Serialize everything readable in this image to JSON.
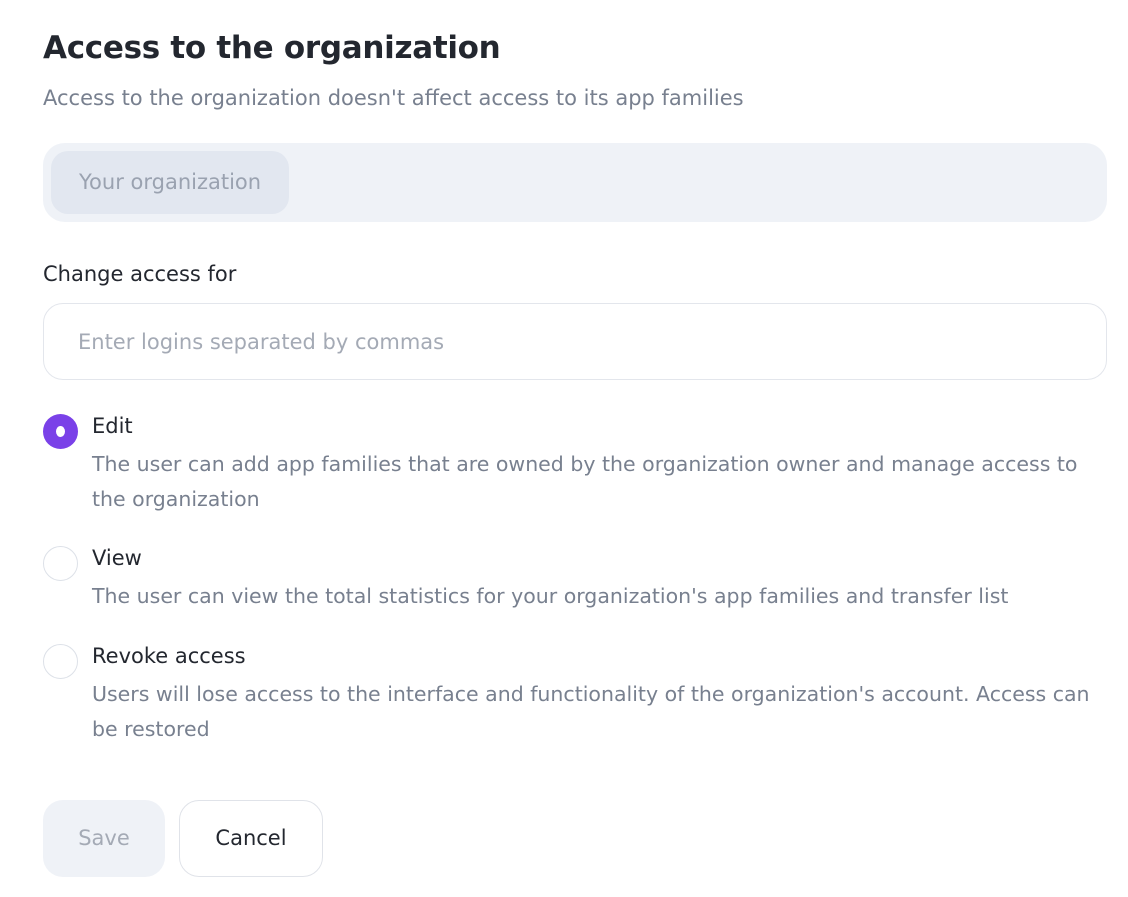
{
  "header": {
    "title": "Access to the organization",
    "subtitle": "Access to the organization doesn't affect access to its app families"
  },
  "organization": {
    "chip_label": "Your organization"
  },
  "change_access": {
    "label": "Change access for",
    "placeholder": "Enter logins separated by commas",
    "value": ""
  },
  "access_options": {
    "selected": "edit",
    "items": [
      {
        "id": "edit",
        "title": "Edit",
        "description": "The user can add app families that are owned by the organization owner and manage access to the organization",
        "checked": true
      },
      {
        "id": "view",
        "title": "View",
        "description": "The user can view the total statistics for your organization's app families and transfer list",
        "checked": false
      },
      {
        "id": "revoke",
        "title": "Revoke access",
        "description": "Users will lose access to the interface and functionality of the organization's account. Access can be restored",
        "checked": false
      }
    ]
  },
  "actions": {
    "save_label": "Save",
    "cancel_label": "Cancel",
    "save_disabled": true
  },
  "colors": {
    "accent": "#7a41e8",
    "muted_text": "#78808f",
    "surface": "#eff2f7"
  }
}
